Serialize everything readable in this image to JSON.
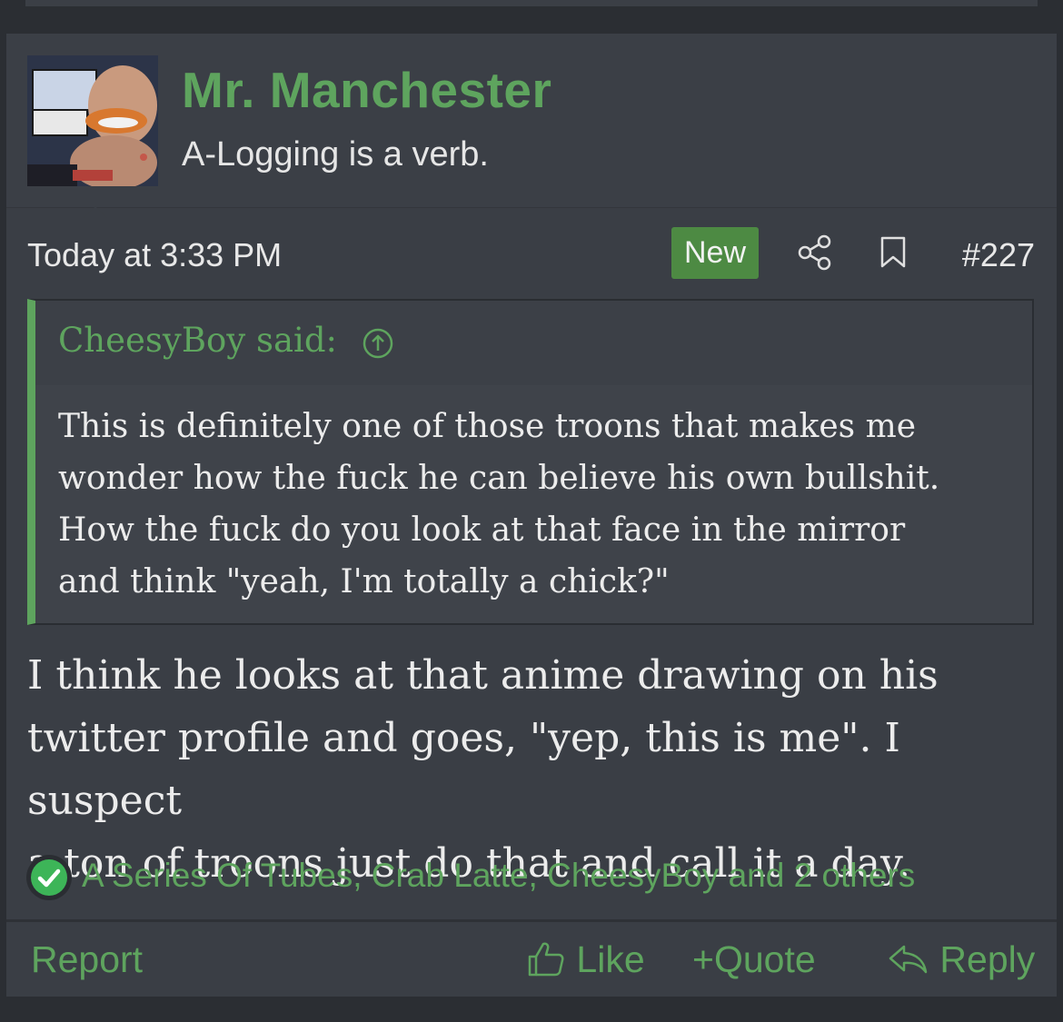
{
  "user": {
    "name": "Mr. Manchester",
    "title": "A-Logging is a verb."
  },
  "meta": {
    "timestamp": "Today at 3:33 PM",
    "badge": "New",
    "post_number": "#227"
  },
  "quote": {
    "author": "CheesyBoy said:",
    "lines": [
      "This is definitely one of those troons that makes me",
      "wonder how the fuck he can believe his own bullshit.",
      "How the fuck do you look at that face in the mirror",
      "and think \"yeah, I'm totally a chick?\""
    ]
  },
  "message": {
    "lines": [
      "I think he looks at that anime drawing on his",
      "twitter profile and goes, \"yep, this is me\". I suspect",
      "a ton of troons just do that and call it a day."
    ]
  },
  "reactions": {
    "text": "A Series Of Tubes, Crab Latte, CheesyBoy and 2 others"
  },
  "actions": {
    "report": "Report",
    "like": "Like",
    "quote": "Quote",
    "quote_prefix": "+",
    "reply": "Reply"
  },
  "colors": {
    "accent": "#5ea45e",
    "badge": "#4d8a43",
    "card": "#3a3e45",
    "background": "#2b2e33"
  },
  "icons": {
    "share": "share-icon",
    "bookmark": "bookmark-icon",
    "quote_jump": "arrow-up-circle-icon",
    "reaction": "checkmark-circle-icon",
    "like": "thumbs-up-icon",
    "reply": "reply-arrow-icon"
  }
}
